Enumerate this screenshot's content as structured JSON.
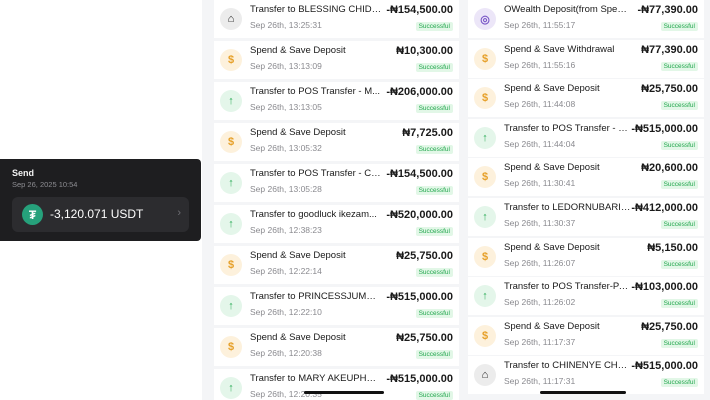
{
  "send_card": {
    "title": "Send",
    "timestamp": "Sep 26, 2025 10:54",
    "amount": "-3,120.071 USDT",
    "icon": "tether-icon",
    "chevron": "›"
  },
  "panel_left": {
    "transactions": [
      {
        "icon": "bank",
        "title": "Transfer to BLESSING CHIDIN...",
        "date": "Sep 26th, 13:25:31",
        "amount": "-₦154,500.00",
        "status": "Successful"
      },
      {
        "icon": "bag",
        "title": "Spend & Save Deposit",
        "date": "Sep 26th, 13:13:09",
        "amount": "₦10,300.00",
        "status": "Successful"
      },
      {
        "icon": "arrow",
        "title": "Transfer to POS Transfer - M...",
        "date": "Sep 26th, 13:13:05",
        "amount": "-₦206,000.00",
        "status": "Successful"
      },
      {
        "icon": "bag",
        "title": "Spend & Save Deposit",
        "date": "Sep 26th, 13:05:32",
        "amount": "₦7,725.00",
        "status": "Successful"
      },
      {
        "icon": "arrow",
        "title": "Transfer to POS Transfer - CH...",
        "date": "Sep 26th, 13:05:28",
        "amount": "-₦154,500.00",
        "status": "Successful"
      },
      {
        "icon": "arrow",
        "title": "Transfer to goodluck ikezam...",
        "date": "Sep 26th, 12:38:23",
        "amount": "-₦520,000.00",
        "status": "Successful"
      },
      {
        "icon": "bag",
        "title": "Spend & Save Deposit",
        "date": "Sep 26th, 12:22:14",
        "amount": "₦25,750.00",
        "status": "Successful"
      },
      {
        "icon": "arrow",
        "title": "Transfer to PRINCESSJUMBO...",
        "date": "Sep 26th, 12:22:10",
        "amount": "-₦515,000.00",
        "status": "Successful"
      },
      {
        "icon": "bag",
        "title": "Spend & Save Deposit",
        "date": "Sep 26th, 12:20:38",
        "amount": "₦25,750.00",
        "status": "Successful"
      },
      {
        "icon": "arrow",
        "title": "Transfer to MARY AKEUPHEL...",
        "date": "Sep 26th, 12:20:35",
        "amount": "-₦515,000.00",
        "status": "Successful"
      }
    ]
  },
  "panel_right": {
    "transactions": [
      {
        "icon": "ow",
        "title": "OWealth Deposit(from Spend &...",
        "date": "Sep 26th, 11:55:17",
        "amount": "-₦77,390.00",
        "status": "Successful"
      },
      {
        "icon": "bag",
        "title": "Spend & Save Withdrawal",
        "date": "Sep 26th, 11:55:16",
        "amount": "₦77,390.00",
        "status": "Successful"
      },
      {
        "icon": "bag",
        "title": "Spend & Save Deposit",
        "date": "Sep 26th, 11:44:08",
        "amount": "₦25,750.00",
        "status": "Successful"
      },
      {
        "icon": "arrow",
        "title": "Transfer to POS Transfer - M...",
        "date": "Sep 26th, 11:44:04",
        "amount": "-₦515,000.00",
        "status": "Successful"
      },
      {
        "icon": "bag",
        "title": "Spend & Save Deposit",
        "date": "Sep 26th, 11:30:41",
        "amount": "₦20,600.00",
        "status": "Successful"
      },
      {
        "icon": "arrow",
        "title": "Transfer to LEDORNUBARI D...",
        "date": "Sep 26th, 11:30:37",
        "amount": "-₦412,000.00",
        "status": "Successful"
      },
      {
        "icon": "bag",
        "title": "Spend & Save Deposit",
        "date": "Sep 26th, 11:26:07",
        "amount": "₦5,150.00",
        "status": "Successful"
      },
      {
        "icon": "arrow",
        "title": "Transfer to POS Transfer-PAU...",
        "date": "Sep 26th, 11:26:02",
        "amount": "-₦103,000.00",
        "status": "Successful"
      },
      {
        "icon": "bag",
        "title": "Spend & Save Deposit",
        "date": "Sep 26th, 11:17:37",
        "amount": "₦25,750.00",
        "status": "Successful"
      },
      {
        "icon": "bank",
        "title": "Transfer to CHINENYE CHRIS...",
        "date": "Sep 26th, 11:17:31",
        "amount": "-₦515,000.00",
        "status": "Successful"
      }
    ]
  },
  "colors": {
    "success_text": "#1fa64b",
    "success_bg": "#e2f7e7",
    "send_card_bg": "#1e1e20",
    "usdt_green": "#26a17b"
  }
}
